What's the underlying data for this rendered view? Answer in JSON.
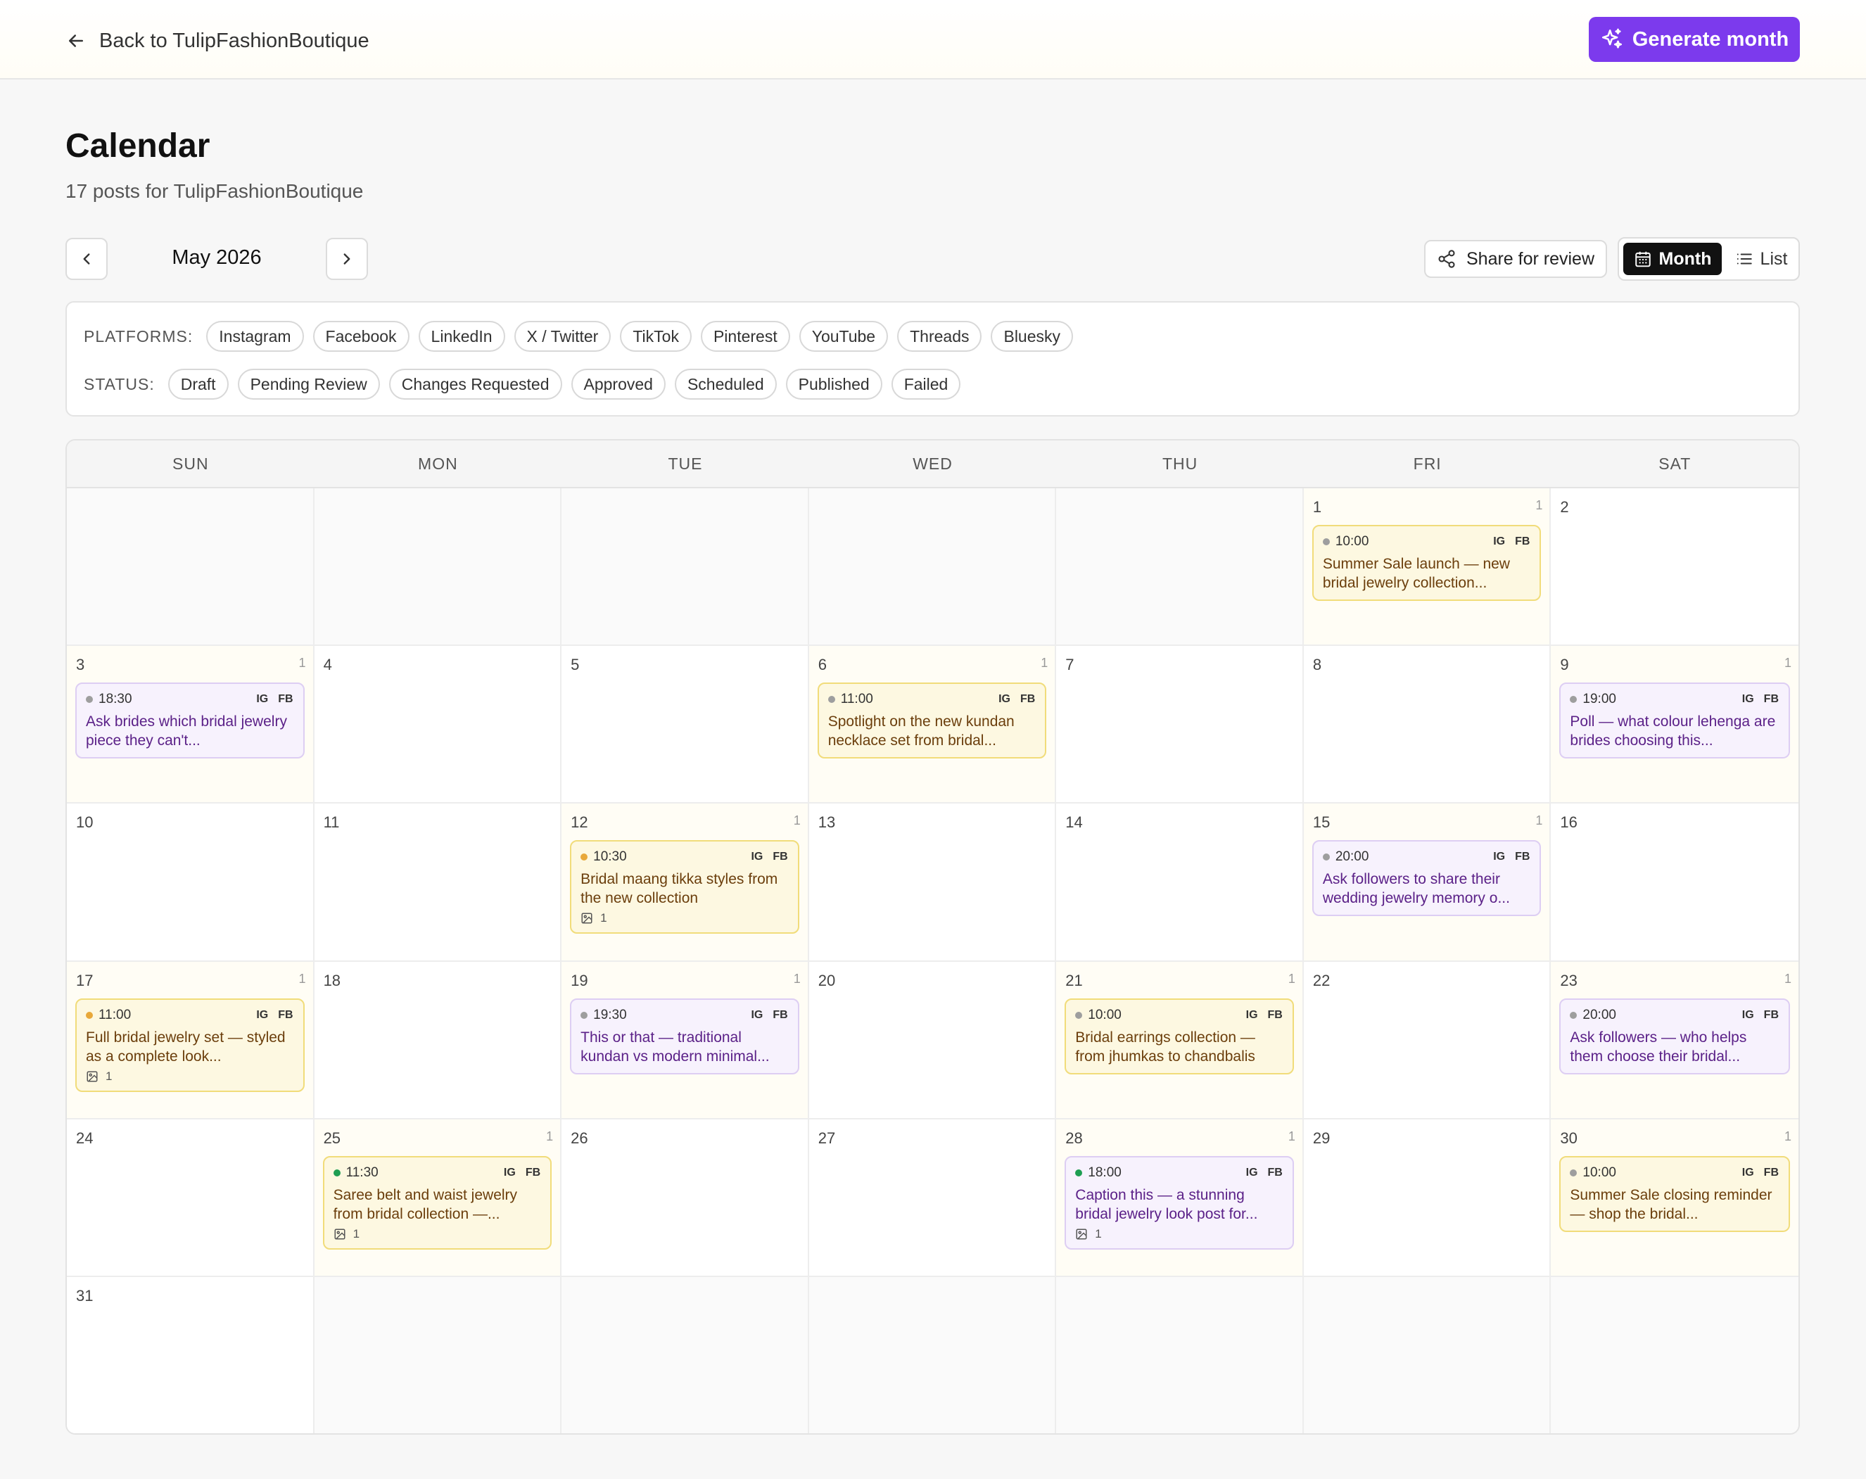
{
  "header": {
    "back_label": "Back to TulipFashionBoutique",
    "generate_label": "Generate month",
    "accent": "#7c3aed"
  },
  "page": {
    "title": "Calendar",
    "subtitle": "17 posts for TulipFashionBoutique"
  },
  "nav": {
    "month_label": "May 2026",
    "share_label": "Share for review",
    "view_month_label": "Month",
    "view_list_label": "List",
    "active_view": "Month"
  },
  "filters": {
    "platforms_label": "PLATFORMS:",
    "platforms": [
      "Instagram",
      "Facebook",
      "LinkedIn",
      "X / Twitter",
      "TikTok",
      "Pinterest",
      "YouTube",
      "Threads",
      "Bluesky"
    ],
    "status_label": "STATUS:",
    "statuses": [
      "Draft",
      "Pending Review",
      "Changes Requested",
      "Approved",
      "Scheduled",
      "Published",
      "Failed"
    ]
  },
  "calendar": {
    "weekdays": [
      "SUN",
      "MON",
      "TUE",
      "WED",
      "THU",
      "FRI",
      "SAT"
    ],
    "status_colors": {
      "gray": "#9e9e9e",
      "amber": "#e8a83a",
      "green": "#1e9e52"
    },
    "cells": [
      {
        "day": ""
      },
      {
        "day": ""
      },
      {
        "day": ""
      },
      {
        "day": ""
      },
      {
        "day": ""
      },
      {
        "day": "1",
        "count": "1",
        "post": {
          "time": "10:00",
          "platforms": [
            "IG",
            "FB"
          ],
          "text": "Summer Sale launch — new bridal jewelry collection...",
          "color": "yellow",
          "status": "gray"
        }
      },
      {
        "day": "2"
      },
      {
        "day": "3",
        "count": "1",
        "post": {
          "time": "18:30",
          "platforms": [
            "IG",
            "FB"
          ],
          "text": "Ask brides which bridal jewelry piece they can't...",
          "color": "purple",
          "status": "gray"
        }
      },
      {
        "day": "4"
      },
      {
        "day": "5"
      },
      {
        "day": "6",
        "count": "1",
        "post": {
          "time": "11:00",
          "platforms": [
            "IG",
            "FB"
          ],
          "text": "Spotlight on the new kundan necklace set from bridal...",
          "color": "yellow",
          "status": "gray"
        }
      },
      {
        "day": "7"
      },
      {
        "day": "8"
      },
      {
        "day": "9",
        "count": "1",
        "post": {
          "time": "19:00",
          "platforms": [
            "IG",
            "FB"
          ],
          "text": "Poll — what colour lehenga are brides choosing this...",
          "color": "purple",
          "status": "gray"
        }
      },
      {
        "day": "10"
      },
      {
        "day": "11"
      },
      {
        "day": "12",
        "count": "1",
        "post": {
          "time": "10:30",
          "platforms": [
            "IG",
            "FB"
          ],
          "text": "Bridal maang tikka styles from the new collection",
          "color": "yellow",
          "status": "amber",
          "media": "1"
        }
      },
      {
        "day": "13"
      },
      {
        "day": "14"
      },
      {
        "day": "15",
        "count": "1",
        "post": {
          "time": "20:00",
          "platforms": [
            "IG",
            "FB"
          ],
          "text": "Ask followers to share their wedding jewelry memory o...",
          "color": "purple",
          "status": "gray"
        }
      },
      {
        "day": "16"
      },
      {
        "day": "17",
        "count": "1",
        "post": {
          "time": "11:00",
          "platforms": [
            "IG",
            "FB"
          ],
          "text": "Full bridal jewelry set — styled as a complete look...",
          "color": "yellow",
          "status": "amber",
          "media": "1"
        }
      },
      {
        "day": "18"
      },
      {
        "day": "19",
        "count": "1",
        "post": {
          "time": "19:30",
          "platforms": [
            "IG",
            "FB"
          ],
          "text": "This or that — traditional kundan vs modern minimal...",
          "color": "purple",
          "status": "gray"
        }
      },
      {
        "day": "20"
      },
      {
        "day": "21",
        "count": "1",
        "post": {
          "time": "10:00",
          "platforms": [
            "IG",
            "FB"
          ],
          "text": "Bridal earrings collection — from jhumkas to chandbalis",
          "color": "yellow",
          "status": "gray"
        }
      },
      {
        "day": "22"
      },
      {
        "day": "23",
        "count": "1",
        "post": {
          "time": "20:00",
          "platforms": [
            "IG",
            "FB"
          ],
          "text": "Ask followers — who helps them choose their bridal...",
          "color": "purple",
          "status": "gray"
        }
      },
      {
        "day": "24"
      },
      {
        "day": "25",
        "count": "1",
        "post": {
          "time": "11:30",
          "platforms": [
            "IG",
            "FB"
          ],
          "text": "Saree belt and waist jewelry from bridal collection —...",
          "color": "yellow",
          "status": "green",
          "media": "1"
        }
      },
      {
        "day": "26"
      },
      {
        "day": "27"
      },
      {
        "day": "28",
        "count": "1",
        "post": {
          "time": "18:00",
          "platforms": [
            "IG",
            "FB"
          ],
          "text": "Caption this — a stunning bridal jewelry look post for...",
          "color": "purple",
          "status": "green",
          "media": "1"
        }
      },
      {
        "day": "29"
      },
      {
        "day": "30",
        "count": "1",
        "post": {
          "time": "10:00",
          "platforms": [
            "IG",
            "FB"
          ],
          "text": "Summer Sale closing reminder — shop the bridal...",
          "color": "yellow",
          "status": "gray"
        }
      },
      {
        "day": "31"
      },
      {
        "day": ""
      },
      {
        "day": ""
      },
      {
        "day": ""
      },
      {
        "day": ""
      },
      {
        "day": ""
      },
      {
        "day": ""
      }
    ]
  }
}
